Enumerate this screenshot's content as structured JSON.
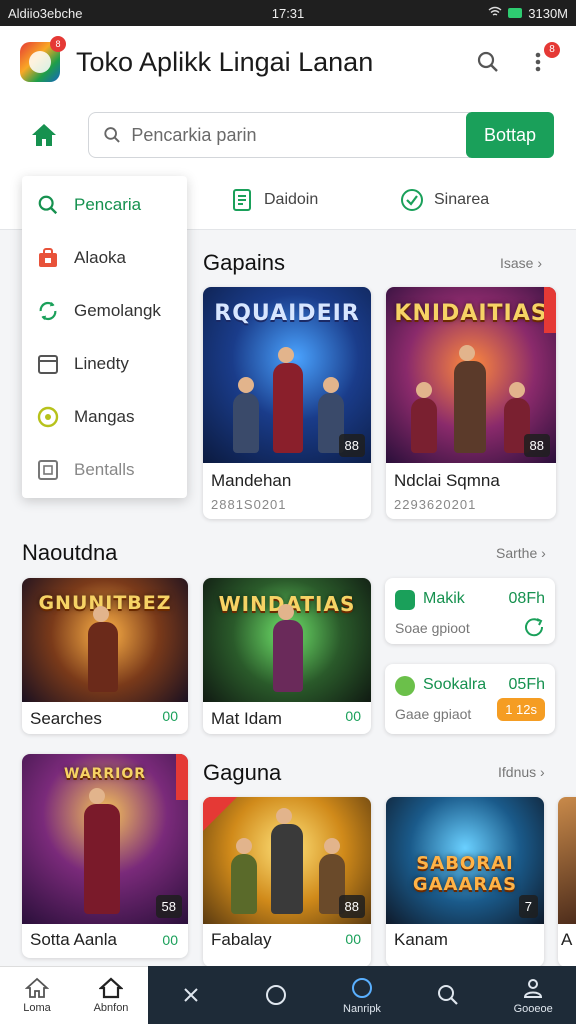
{
  "status_bar": {
    "left": "Aldiio3ebche",
    "time": "17:31",
    "right": "3130M"
  },
  "app_bar": {
    "title": "Toko Aplikk Lingai Lanan",
    "logo_badge": "8",
    "more_badge": "8"
  },
  "search": {
    "placeholder": "Pencarkia parin",
    "button_label": "Bottap"
  },
  "tabs": [
    {
      "label": "Daidoin",
      "icon": "document-icon"
    },
    {
      "label": "Sinarea",
      "icon": "check-circle-icon"
    }
  ],
  "dropdown": {
    "items": [
      {
        "label": "Pencaria",
        "icon": "search-icon",
        "state": "active"
      },
      {
        "label": "Alaoka",
        "icon": "bag-icon",
        "state": "normal"
      },
      {
        "label": "Gemolangk",
        "icon": "refresh-icon",
        "state": "normal"
      },
      {
        "label": "Linedty",
        "icon": "calendar-icon",
        "state": "normal"
      },
      {
        "label": "Mangas",
        "icon": "coin-icon",
        "state": "normal"
      },
      {
        "label": "Bentalls",
        "icon": "box-icon",
        "state": "muted"
      }
    ]
  },
  "sections": {
    "gapains": {
      "title": "Gapains",
      "more": "Isase"
    },
    "naoutdna": {
      "title": "Naoutdna",
      "more": "Sarthe"
    },
    "gaguna": {
      "title": "Gaguna",
      "more": "Ifdnus"
    }
  },
  "gapains_cards": [
    {
      "art_title": "RQUAIDEIR",
      "name": "Mandehan",
      "sub": "2881S0201",
      "rating": "88"
    },
    {
      "art_title": "KNIDAITIAS",
      "name": "Ndclai Sqmna",
      "sub": "2293620201",
      "rating": "88"
    }
  ],
  "naoutdna_cards": [
    {
      "art_title": "GNUNITBEZ",
      "name": "Searches",
      "price": "00"
    },
    {
      "art_title": "WINDATIAS",
      "name": "Mat Idam",
      "price": "00"
    }
  ],
  "apps": [
    {
      "name": "Makik",
      "size": "08Fh",
      "sub": "Soae gpioot"
    },
    {
      "name": "Sookalra",
      "size": "05Fh",
      "sub": "Gaae gpiaot",
      "badge": "1 12s"
    }
  ],
  "gaguna_cards": [
    {
      "art_title": "WARRIOR",
      "name": "Sotta Aanla",
      "price": "00",
      "rating": "58"
    },
    {
      "art_title": "",
      "name": "Fabalay",
      "price": "00",
      "rating": "88"
    },
    {
      "art_title": "SABORAI GAAARAS",
      "name": "Kanam",
      "rating": "7"
    },
    {
      "art_title": "",
      "name": "A"
    }
  ],
  "bottom_nav": {
    "light": [
      {
        "label": "Loma",
        "icon": "home-icon"
      },
      {
        "label": "Abnfon",
        "icon": "home-outline-icon"
      }
    ],
    "dark": [
      {
        "label": "",
        "icon": "close-icon"
      },
      {
        "label": "",
        "icon": "circle-icon"
      },
      {
        "label": "Nanripk",
        "icon": "circle-active-icon"
      },
      {
        "label": "",
        "icon": "search-icon"
      },
      {
        "label": "Gooeoe",
        "icon": "user-icon"
      }
    ]
  },
  "colors": {
    "accent": "#1aa05a",
    "badge": "#e53935",
    "warning": "#f59d23",
    "nav_dark": "#1e2b38"
  }
}
